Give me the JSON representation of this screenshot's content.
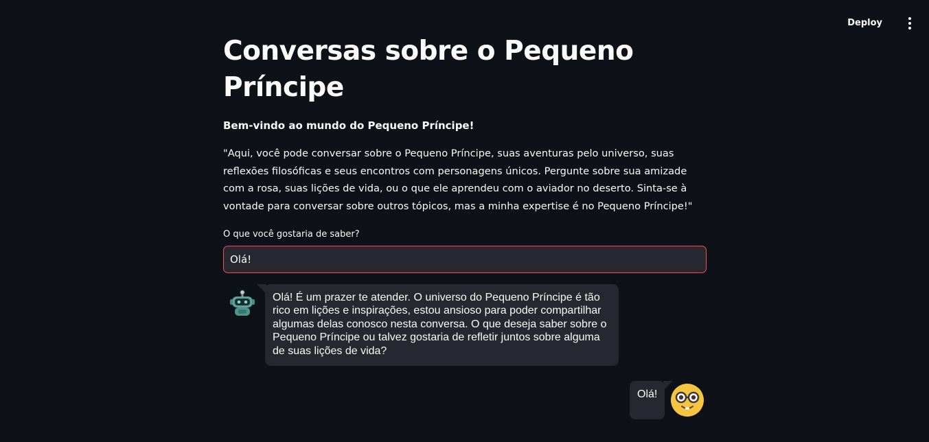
{
  "header": {
    "deploy_label": "Deploy",
    "menu_icon": "vertical-ellipsis-icon"
  },
  "main": {
    "title": "Conversas sobre o Pequeno Príncipe",
    "welcome": "Bem-vindo ao mundo do Pequeno Príncipe!",
    "intro": "\"Aqui, você pode conversar sobre o Pequeno Príncipe, suas aventuras pelo universo, suas reflexões filosóficas e seus encontros com personagens únicos. Pergunte sobre sua amizade com a rosa, suas lições de vida, ou o que ele aprendeu com o aviador no deserto. Sinta-se à vontade para conversar sobre outros tópicos, mas a minha expertise é no Pequeno Príncipe!\"",
    "input": {
      "label": "O que você gostaria de saber?",
      "value": "Olá!"
    }
  },
  "chat": {
    "messages": [
      {
        "role": "bot",
        "avatar_icon": "robot-avatar-icon",
        "text": "Olá! É um prazer te atender. O universo do Pequeno Príncipe é tão rico em lições e inspirações, estou ansioso para poder compartilhar algumas delas conosco nesta conversa. O que deseja saber sobre o Pequeno Príncipe ou talvez gostaria de refletir juntos sobre alguma de suas lições de vida?"
      },
      {
        "role": "user",
        "avatar_icon": "nerd-face-emoji-icon",
        "text": "Olá!"
      }
    ]
  },
  "colors": {
    "background": "#0e1117",
    "surface": "#262730",
    "text": "#fafafa",
    "accent": "#ff4b4b",
    "bot_avatar": "#5aa39a",
    "user_avatar": "#f5c542"
  }
}
